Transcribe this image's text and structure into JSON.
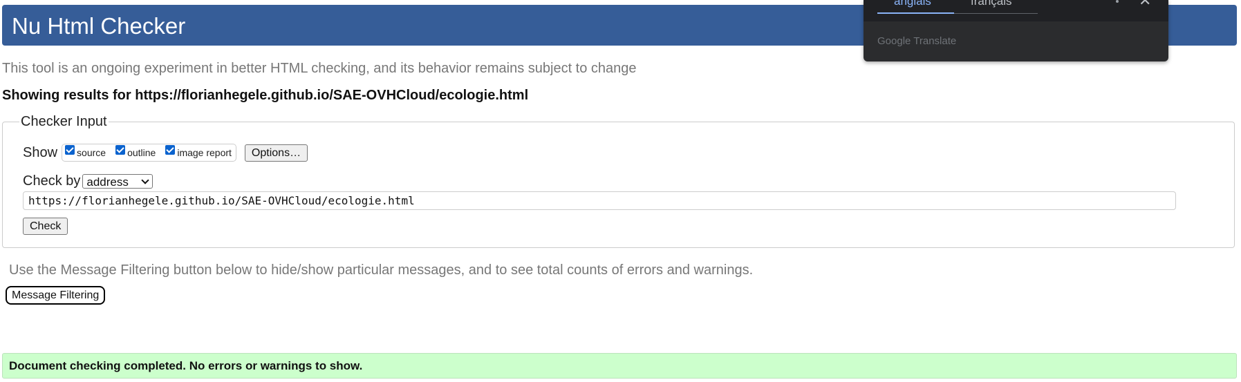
{
  "header": {
    "title": "Nu Html Checker"
  },
  "intro_text": "This tool is an ongoing experiment in better HTML checking, and its behavior remains subject to change",
  "results_heading": "Showing results for https://florianhegele.github.io/SAE-OVHCloud/ecologie.html",
  "checker_input": {
    "legend": "Checker Input",
    "show_label": "Show",
    "options": [
      {
        "label": "source",
        "checked": true
      },
      {
        "label": "outline",
        "checked": true
      },
      {
        "label": "image report",
        "checked": true
      }
    ],
    "options_button": "Options…",
    "check_by_label": "Check by",
    "check_by_value": "address",
    "url_value": "https://florianhegele.github.io/SAE-OVHCloud/ecologie.html",
    "check_button": "Check"
  },
  "filter_text": "Use the Message Filtering button below to hide/show particular messages, and to see total counts of errors and warnings.",
  "filter_button": "Message Filtering",
  "success_message": "Document checking completed. No errors or warnings to show.",
  "translate_popup": {
    "tab_active": "anglais",
    "tab_inactive": "français",
    "brand": "Google Translate",
    "more_icon": "more-vert-icon",
    "close_icon": "close-icon"
  },
  "colors": {
    "header_bg": "#365d98",
    "success_bg": "#ccffcc",
    "muted_text": "#777777",
    "popup_bg": "#2b2c2e",
    "popup_accent": "#8ab4f8"
  }
}
